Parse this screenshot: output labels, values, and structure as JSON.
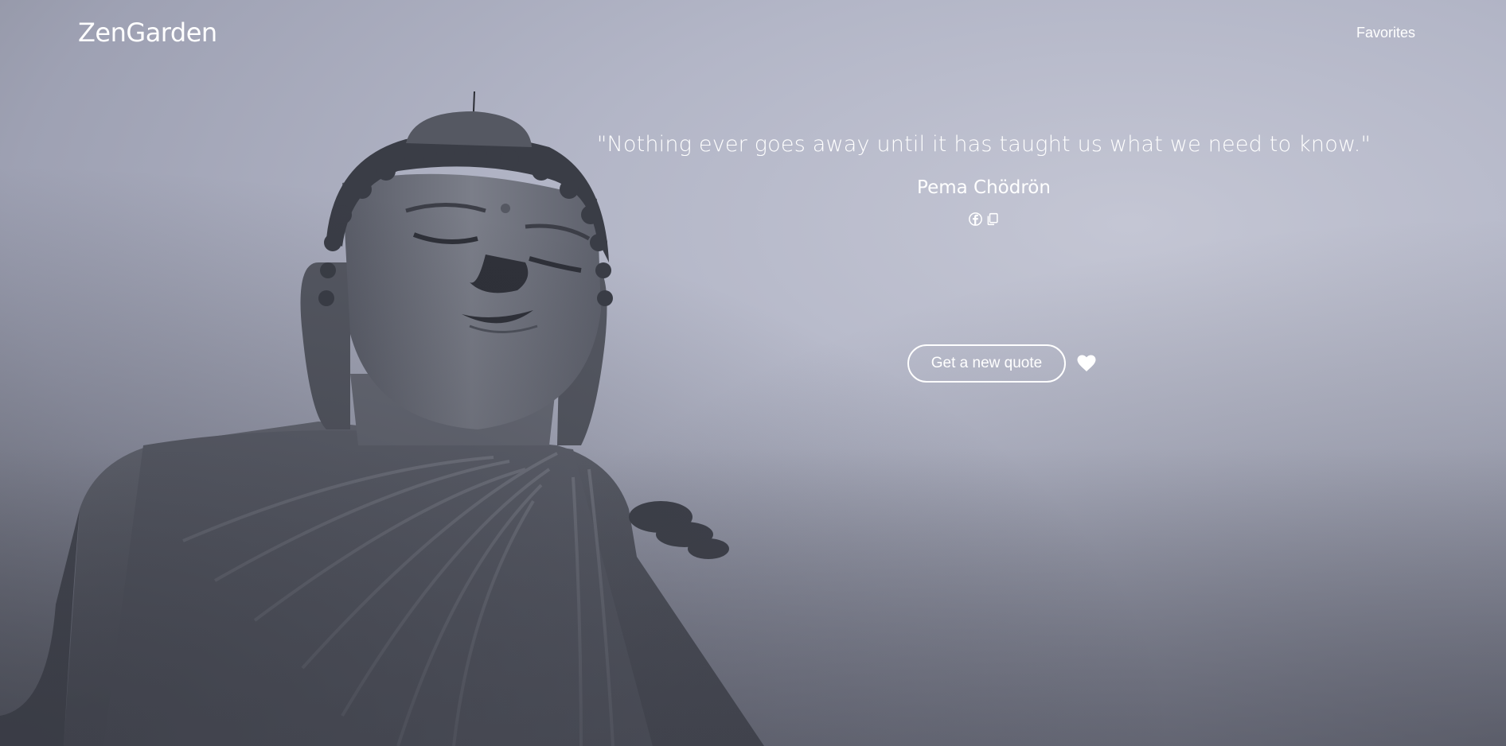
{
  "header": {
    "brand": "ZenGarden",
    "nav_favorites": "Favorites"
  },
  "quote": {
    "text": "\"Nothing ever goes away until it has taught us what we need to know.\"",
    "author": "Pema Chödrön"
  },
  "share": {
    "icons": [
      "facebook-icon",
      "copy-icon"
    ]
  },
  "actions": {
    "new_quote_label": "Get a new quote",
    "favorite_icon": "heart-icon"
  },
  "colors": {
    "text": "#ffffff",
    "background": "#b3b6c7"
  }
}
